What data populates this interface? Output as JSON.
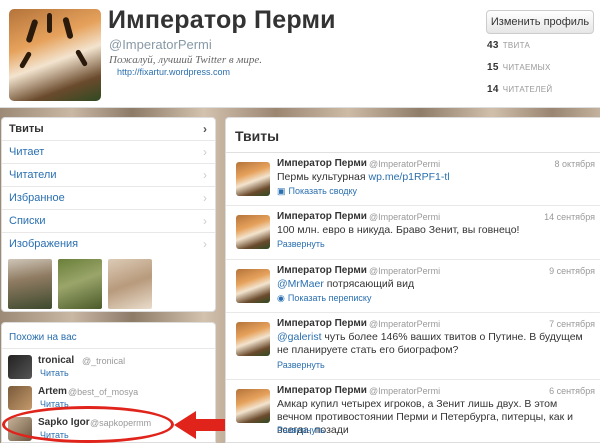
{
  "profile": {
    "name": "Император Перми",
    "handle": "@ImperatorPermi",
    "bio": "Пожалуй, лучший Twitter в мире.",
    "url": "http://fixartur.wordpress.com",
    "edit_label": "Изменить профиль",
    "stats": [
      {
        "value": "43",
        "label": "ТВИТА"
      },
      {
        "value": "15",
        "label": "ЧИТАЕМЫХ"
      },
      {
        "value": "14",
        "label": "ЧИТАТЕЛЕЙ"
      }
    ]
  },
  "nav": {
    "items": [
      {
        "label": "Твиты",
        "active": true
      },
      {
        "label": "Читает"
      },
      {
        "label": "Читатели"
      },
      {
        "label": "Избранное"
      },
      {
        "label": "Списки"
      },
      {
        "label": "Изображения"
      }
    ]
  },
  "who_to_follow": {
    "title": "Похожи на вас",
    "users": [
      {
        "name": "tronical",
        "handle": "@_tronical",
        "follow": "Читать"
      },
      {
        "name": "Artem",
        "handle": "@best_of_mosya",
        "follow": "Читать"
      },
      {
        "name": "Sapko Igor",
        "handle": "@sapkopermm",
        "follow": "Читать"
      }
    ]
  },
  "tweets_panel": {
    "title": "Твиты",
    "tweets": [
      {
        "name": "Император Перми",
        "handle": "@ImperatorPermi",
        "date": "8 октября",
        "text_before": "Пермь культурная ",
        "link": "wp.me/p1RPF1-tl",
        "text_after": "",
        "action": "Показать сводку",
        "action_icon": "summary-icon"
      },
      {
        "name": "Император Перми",
        "handle": "@ImperatorPermi",
        "date": "14 сентября",
        "text_before": "100 млн. евро в никуда. Браво Зенит, вы говнецо!",
        "link": "",
        "text_after": "",
        "action": "Развернуть"
      },
      {
        "name": "Император Перми",
        "handle": "@ImperatorPermi",
        "date": "9 сентября",
        "text_before": "",
        "link": "@MrMaer",
        "text_after": " потрясающий вид",
        "action": "Показать переписку",
        "action_icon": "conversation-icon"
      },
      {
        "name": "Император Перми",
        "handle": "@ImperatorPermi",
        "date": "7 сентября",
        "text_before": "",
        "link": "@galerist",
        "text_after": " чуть более 146% ваших твитов о Путине. В будущем не планируете стать его биографом?",
        "action": "Развернуть"
      },
      {
        "name": "Император Перми",
        "handle": "@ImperatorPermi",
        "date": "6 сентября",
        "text_before": "Амкар купил четырех игроков, а Зенит лишь двух. В этом вечном противостоянии Перми и Петербурга, питерцы, как и всегда, позади",
        "link": "",
        "text_after": "",
        "action": "Развернуть"
      }
    ]
  },
  "colors": {
    "link": "#2a6fb0",
    "highlight": "#e0241c"
  }
}
